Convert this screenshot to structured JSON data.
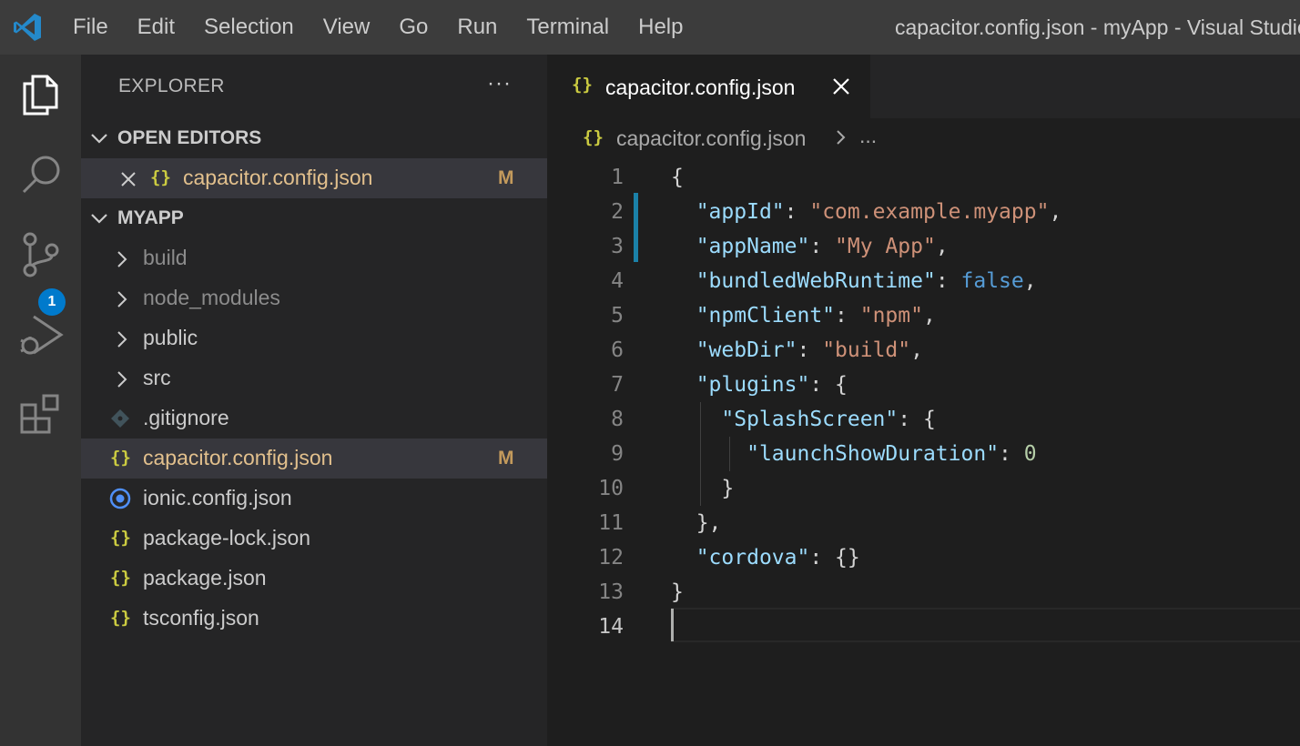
{
  "titlebar": {
    "logo_icon": "vscode-logo-icon",
    "menu": [
      "File",
      "Edit",
      "Selection",
      "View",
      "Go",
      "Run",
      "Terminal",
      "Help"
    ],
    "window_title": "capacitor.config.json - myApp - Visual Studio Code"
  },
  "activitybar": {
    "items": [
      "explorer-icon",
      "search-icon",
      "source-control-icon",
      "run-debug-icon",
      "extensions-icon"
    ],
    "source_control_badge": "1"
  },
  "sidebar": {
    "title": "EXPLORER",
    "more": "···",
    "open_editors": {
      "header": "OPEN EDITORS",
      "items": [
        {
          "name": "capacitor.config.json",
          "status": "M"
        }
      ]
    },
    "project": {
      "header": "MYAPP",
      "folders": [
        "build",
        "node_modules",
        "public",
        "src"
      ],
      "files": [
        {
          "name": ".gitignore",
          "icon": "git-icon"
        },
        {
          "name": "capacitor.config.json",
          "icon": "json-icon",
          "status": "M"
        },
        {
          "name": "ionic.config.json",
          "icon": "ionic-icon"
        },
        {
          "name": "package-lock.json",
          "icon": "json-icon"
        },
        {
          "name": "package.json",
          "icon": "json-icon"
        },
        {
          "name": "tsconfig.json",
          "icon": "json-icon"
        }
      ]
    }
  },
  "editor": {
    "tab": {
      "label": "capacitor.config.json",
      "icon": "{}"
    },
    "breadcrumb": {
      "file": "capacitor.config.json",
      "more": "..."
    },
    "current_line": 14,
    "lines": [
      {
        "n": "1",
        "tokens": [
          [
            "punc",
            "{"
          ]
        ]
      },
      {
        "n": "2",
        "tokens": [
          [
            "punc",
            "  "
          ],
          [
            "key",
            "\"appId\""
          ],
          [
            "punc",
            ": "
          ],
          [
            "str",
            "\"com.example.myapp\""
          ],
          [
            "punc",
            ","
          ]
        ]
      },
      {
        "n": "3",
        "tokens": [
          [
            "punc",
            "  "
          ],
          [
            "key",
            "\"appName\""
          ],
          [
            "punc",
            ": "
          ],
          [
            "str",
            "\"My App\""
          ],
          [
            "punc",
            ","
          ]
        ]
      },
      {
        "n": "4",
        "tokens": [
          [
            "punc",
            "  "
          ],
          [
            "key",
            "\"bundledWebRuntime\""
          ],
          [
            "punc",
            ": "
          ],
          [
            "kw",
            "false"
          ],
          [
            "punc",
            ","
          ]
        ]
      },
      {
        "n": "5",
        "tokens": [
          [
            "punc",
            "  "
          ],
          [
            "key",
            "\"npmClient\""
          ],
          [
            "punc",
            ": "
          ],
          [
            "str",
            "\"npm\""
          ],
          [
            "punc",
            ","
          ]
        ]
      },
      {
        "n": "6",
        "tokens": [
          [
            "punc",
            "  "
          ],
          [
            "key",
            "\"webDir\""
          ],
          [
            "punc",
            ": "
          ],
          [
            "str",
            "\"build\""
          ],
          [
            "punc",
            ","
          ]
        ]
      },
      {
        "n": "7",
        "tokens": [
          [
            "punc",
            "  "
          ],
          [
            "key",
            "\"plugins\""
          ],
          [
            "punc",
            ": {"
          ]
        ]
      },
      {
        "n": "8",
        "tokens": [
          [
            "punc",
            "    "
          ],
          [
            "key",
            "\"SplashScreen\""
          ],
          [
            "punc",
            ": {"
          ]
        ]
      },
      {
        "n": "9",
        "tokens": [
          [
            "punc",
            "      "
          ],
          [
            "key",
            "\"launchShowDuration\""
          ],
          [
            "punc",
            ": "
          ],
          [
            "num",
            "0"
          ]
        ]
      },
      {
        "n": "10",
        "tokens": [
          [
            "punc",
            "    }"
          ]
        ]
      },
      {
        "n": "11",
        "tokens": [
          [
            "punc",
            "  },"
          ]
        ]
      },
      {
        "n": "12",
        "tokens": [
          [
            "punc",
            "  "
          ],
          [
            "key",
            "\"cordova\""
          ],
          [
            "punc",
            ": {}"
          ]
        ]
      },
      {
        "n": "13",
        "tokens": [
          [
            "punc",
            "}"
          ]
        ]
      },
      {
        "n": "14",
        "tokens": []
      }
    ]
  }
}
